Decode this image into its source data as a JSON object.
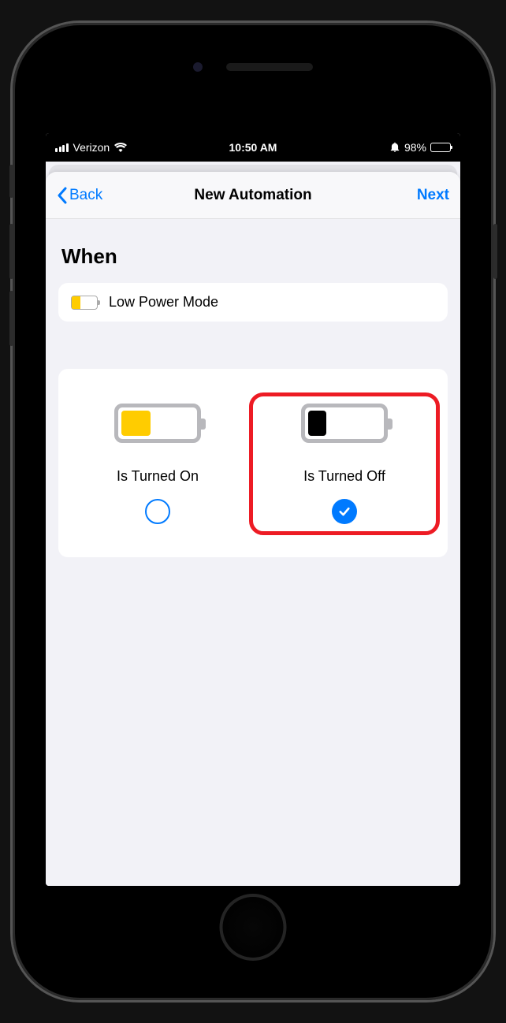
{
  "status_bar": {
    "carrier": "Verizon",
    "time": "10:50 AM",
    "battery_percent": "98%"
  },
  "nav": {
    "back_label": "Back",
    "title": "New Automation",
    "next_label": "Next"
  },
  "section": {
    "title": "When"
  },
  "trigger": {
    "label": "Low Power Mode"
  },
  "options": {
    "on": {
      "label": "Is Turned On",
      "selected": false
    },
    "off": {
      "label": "Is Turned Off",
      "selected": true
    }
  }
}
